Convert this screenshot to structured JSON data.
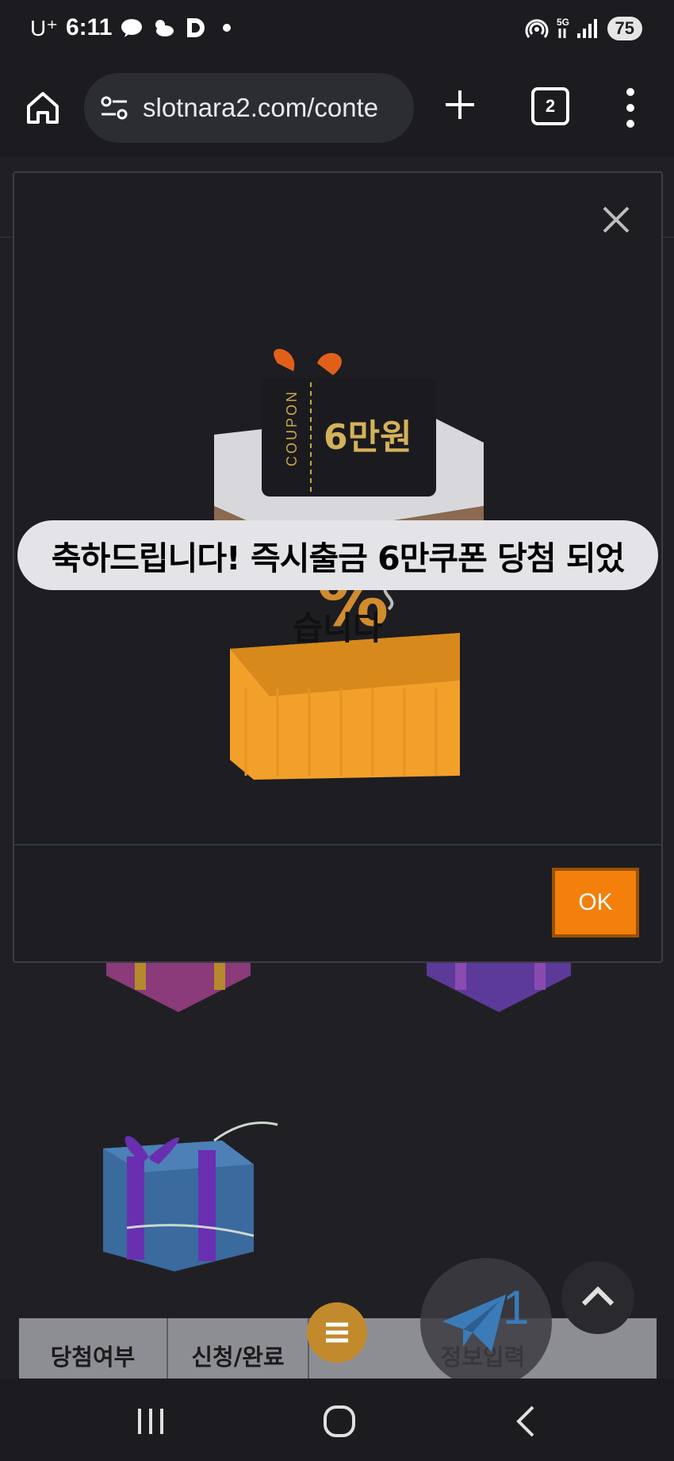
{
  "status_bar": {
    "carrier": "U⁺",
    "time": "6:11",
    "battery": "75",
    "icons": [
      "talk-icon",
      "weather-icon",
      "d-app-icon",
      "dot-icon",
      "hotspot-icon",
      "5g-signal-icon"
    ]
  },
  "browser": {
    "url": "slotnara2.com/conte",
    "tab_count": "2",
    "icons": [
      "home-icon",
      "site-settings-icon",
      "plus-icon",
      "tabs-icon",
      "overflow-menu-icon"
    ]
  },
  "dialog": {
    "coupon_label": "COUPON",
    "coupon_amount": "6만원",
    "message_line1": "축하드립니다! 즉시출금 6만쿠폰 당첨 되었",
    "message_line2": "습니다",
    "ok_label": "OK"
  },
  "background": {
    "tabs": [
      "당첨여부",
      "신청/완료",
      "정보입력"
    ],
    "telegram_count": "1"
  },
  "colors": {
    "ok_button": "#f2800a",
    "dialog_bg": "#1d1d22",
    "message_bg": "#e4e4e8"
  }
}
